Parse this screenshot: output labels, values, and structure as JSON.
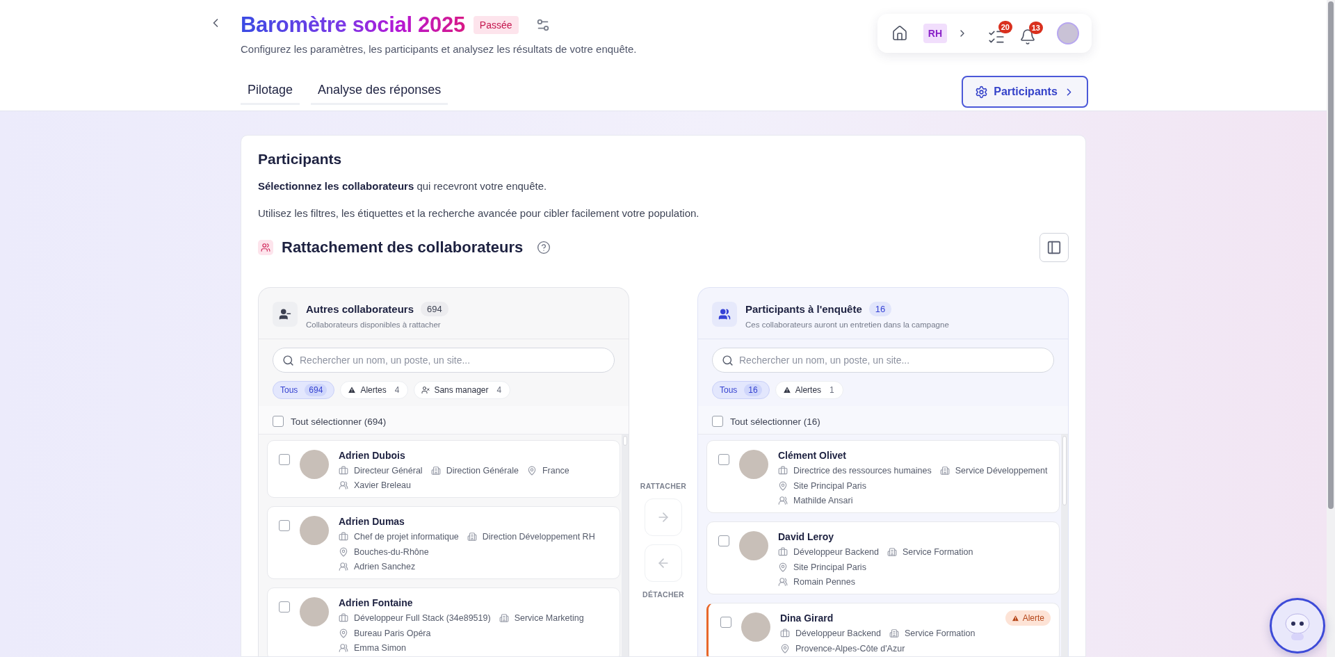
{
  "header": {
    "title": "Baromètre social 2025",
    "status": "Passée",
    "subtitle": "Configurez les paramètres, les participants et analysez les résultats de votre enquête."
  },
  "tabs": [
    {
      "label": "Pilotage",
      "selected": false
    },
    {
      "label": "Analyse des réponses",
      "selected": false
    }
  ],
  "nav": {
    "space": "RH",
    "tasks_count": "20",
    "notifications_count": "13"
  },
  "participants_button": "Participants",
  "card": {
    "title": "Participants",
    "lead": "**Sélectionnez les collaborateurs** qui recevront votre enquête.",
    "hint": "Utilisez les filtres, les étiquettes et la recherche avancée pour cibler facilement votre population.",
    "section_title": "Rattachement des collaborateurs"
  },
  "panels": [
    {
      "kind": "available",
      "title": "Autres collaborateurs",
      "count": "694",
      "subtitle": "Collaborateurs disponibles à rattacher",
      "search": {
        "placeholder": "Rechercher un nom, un poste, un site..."
      },
      "filters": [
        {
          "kind": "all",
          "label": "Tous",
          "count": "694",
          "selected": true
        },
        {
          "kind": "alert",
          "label": "Alertes",
          "count": "4",
          "selected": false
        },
        {
          "kind": "no-manager",
          "label": "Sans manager",
          "count": "4",
          "selected": false
        }
      ],
      "select_all": {
        "label": "Tout sélectionner (694)",
        "checked": false
      },
      "people": [
        {
          "name": "Adrien Dubois",
          "checked": false,
          "alert": false,
          "job": "Directeur Général",
          "department": "Direction Générale",
          "location": "France",
          "manager": "Xavier Breleau"
        },
        {
          "name": "Adrien Dumas",
          "checked": false,
          "alert": false,
          "job": "Chef de projet informatique",
          "department": "Direction Développement RH",
          "location": "Bouches-du-Rhône",
          "manager": "Adrien Sanchez"
        },
        {
          "name": "Adrien Fontaine",
          "checked": false,
          "alert": false,
          "job": "Développeur Full Stack (34e89519)",
          "department": "Service Marketing",
          "location": "Bureau Paris Opéra",
          "manager": "Emma Simon"
        }
      ]
    },
    {
      "kind": "participants",
      "title": "Participants à l'enquête",
      "count": "16",
      "subtitle": "Ces collaborateurs auront un entretien dans la campagne",
      "search": {
        "placeholder": "Rechercher un nom, un poste, un site..."
      },
      "filters": [
        {
          "kind": "all",
          "label": "Tous",
          "count": "16",
          "selected": true
        },
        {
          "kind": "alert",
          "label": "Alertes",
          "count": "1",
          "selected": false
        }
      ],
      "select_all": {
        "label": "Tout sélectionner (16)",
        "checked": false
      },
      "people": [
        {
          "name": "Clément Olivet",
          "checked": false,
          "alert": false,
          "job": "Directrice des ressources humaines",
          "department": "Service Développement",
          "location": "Site Principal Paris",
          "manager": "Mathilde Ansari"
        },
        {
          "name": "David Leroy",
          "checked": false,
          "alert": false,
          "job": "Développeur Backend",
          "department": "Service Formation",
          "location": "Site Principal Paris",
          "manager": "Romain Pennes"
        },
        {
          "name": "Dina Girard",
          "checked": false,
          "alert": true,
          "alert_label": "Alerte",
          "job": "Développeur Backend",
          "department": "Service Formation",
          "location": "Provence-Alpes-Côte d'Azur"
        }
      ]
    }
  ],
  "transfer": {
    "attach_label": "RATTACHER",
    "detach_label": "DÉTACHER",
    "attach_disabled": true,
    "detach_disabled": true
  }
}
